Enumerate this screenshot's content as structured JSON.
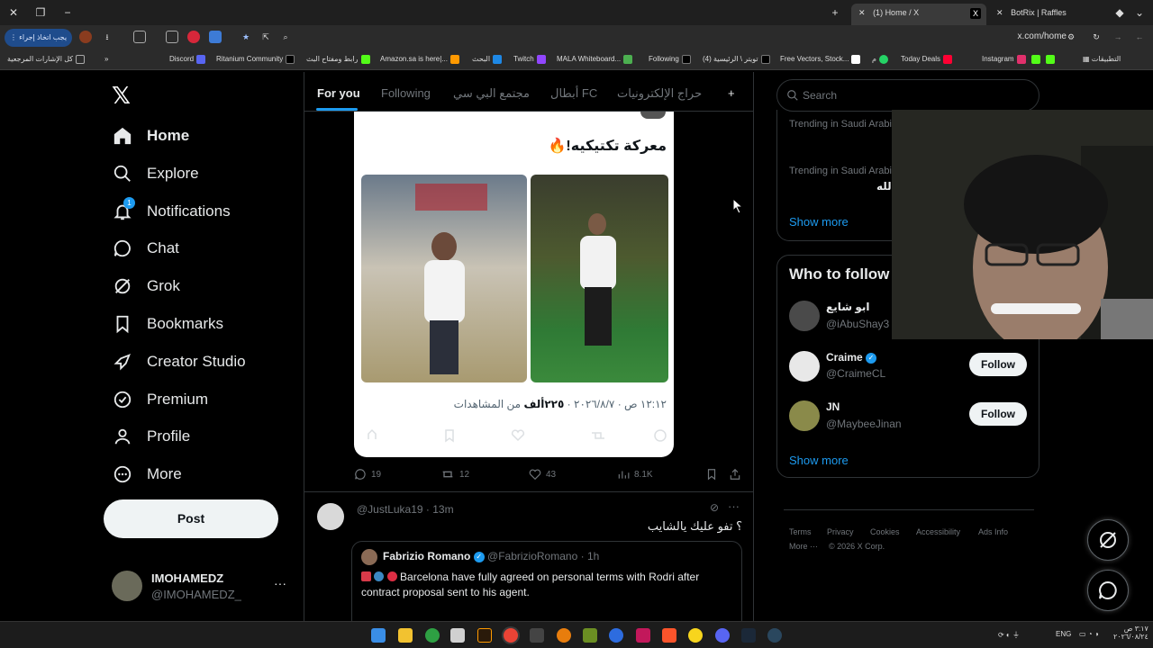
{
  "browser": {
    "tabs": [
      {
        "title": "(1) Home / X",
        "active": true
      },
      {
        "title": "BotRix | Raffles",
        "active": false
      }
    ],
    "update_button": "يجب اتخاذ إجراء",
    "url": "x.com/home",
    "bookmarks": [
      "التطبيقات",
      "Instagram",
      "Today Deals",
      "م",
      "Free Vectors, Stock...",
      "(4) تويتر \\ الرئيسية",
      "Following",
      "MALA Whiteboard...",
      "Twitch",
      "البحث",
      "Amazon.sa is here|...",
      "رابط ومفتاح البث",
      "Ritanium Community",
      "Discord",
      "كل الإشارات المرجعية"
    ]
  },
  "sidebar": {
    "items": [
      {
        "label": "Home",
        "icon": "home-icon"
      },
      {
        "label": "Explore",
        "icon": "search-icon"
      },
      {
        "label": "Notifications",
        "icon": "bell-icon",
        "badge": "1"
      },
      {
        "label": "Chat",
        "icon": "chat-icon"
      },
      {
        "label": "Grok",
        "icon": "grok-icon"
      },
      {
        "label": "Bookmarks",
        "icon": "bookmark-icon"
      },
      {
        "label": "Creator Studio",
        "icon": "rocket-icon"
      },
      {
        "label": "Premium",
        "icon": "premium-icon"
      },
      {
        "label": "Profile",
        "icon": "person-icon"
      },
      {
        "label": "More",
        "icon": "more-circle-icon"
      }
    ],
    "post_button": "Post",
    "user": {
      "name": "IMOHAMEDZ",
      "handle": "@IMOHAMEDZ_"
    }
  },
  "timeline": {
    "tabs": [
      "For you",
      "Following",
      "مجتمع البي سي",
      "أبطال FC",
      "حراج الإلكترونيات"
    ],
    "tweet1": {
      "text": "معركة تكتيكيه!🔥",
      "meta_time": "١٢:١٢ ص · ٢٠٢٦/٨/٧",
      "meta_views_num": "٢٢٥ألف",
      "meta_views_label": "من المشاهدات",
      "replies": "19",
      "reposts": "12",
      "likes": "43",
      "views": "8.1K"
    },
    "tweet2": {
      "handle": "@JustLuka19",
      "time": "13m",
      "text": "؟ تفو عليك يالشايب",
      "quote": {
        "name": "Fabrizio Romano",
        "handle": "@FabrizioRomano",
        "time": "1h",
        "text": "Barcelona have fully agreed on personal terms with Rodri after contract proposal sent to his agent."
      }
    }
  },
  "right": {
    "search_placeholder": "Search",
    "trending": [
      {
        "context": "Trending in Saudi Arabia",
        "title": ""
      },
      {
        "context": "Trending in Saudi Arabia",
        "title": "لله"
      }
    ],
    "show_more": "Show more",
    "who_to_follow_title": "Who to follow",
    "follow_suggestions": [
      {
        "name": "ابو شايع",
        "handle": "@iAbuShay3",
        "verified": false,
        "button": ""
      },
      {
        "name": "Craime",
        "handle": "@CraimeCL",
        "verified": true,
        "button": "Follow"
      },
      {
        "name": "JN",
        "handle": "@MaybeeJinan",
        "verified": false,
        "button": "Follow"
      }
    ],
    "footer": [
      "Terms",
      "Privacy",
      "Cookies",
      "Accessibility",
      "Ads Info",
      "More ···",
      "© 2026 X Corp."
    ]
  },
  "taskbar": {
    "lang": "ENG",
    "time": "٣:١٧ ص",
    "date": "٢٠٢٦/٠٨/٢٤"
  },
  "colors": {
    "accent": "#1d9bf0",
    "bg": "#000000",
    "text": "#e7e9ea",
    "muted": "#71767b",
    "border": "#2f3336"
  }
}
